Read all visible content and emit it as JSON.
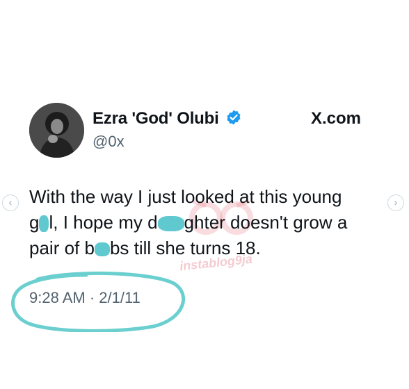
{
  "post": {
    "author_name": "Ezra 'God' Olubi",
    "handle": "@0x",
    "site": "X.com",
    "text_lines": [
      [
        "With the way I just looked at this young"
      ],
      [
        "g",
        "l, I hope my d",
        "ghter doesn't grow a"
      ],
      [
        "pair of b",
        "bs till she turns 18."
      ]
    ],
    "timestamp": "9:28 AM · 2/1/11"
  },
  "watermark": {
    "text": "instablog9ja"
  },
  "navigation": {
    "prev_icon": "‹",
    "next_icon": "›"
  },
  "colors": {
    "verified": "#1d9bf0",
    "highlight_circle": "#6ccfcf",
    "censor_blot": "#5fc9cf"
  }
}
